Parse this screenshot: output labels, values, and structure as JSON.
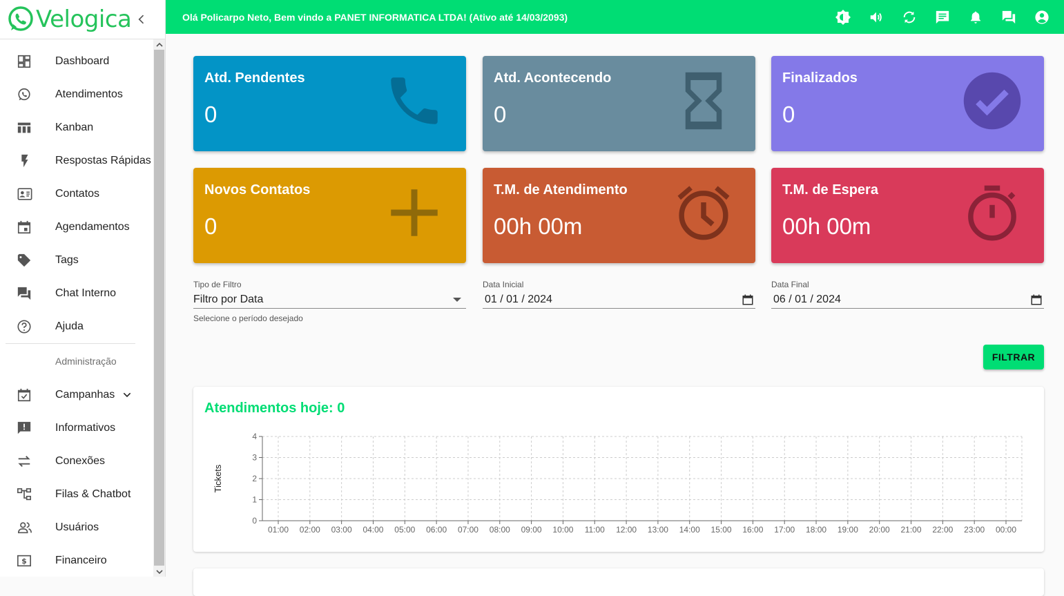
{
  "brand": {
    "logo_text": "Velogica",
    "accent": "#00dd74",
    "logo_color": "#25c35b"
  },
  "sidebar": {
    "items": [
      {
        "label": "Dashboard",
        "icon": "dashboard-icon"
      },
      {
        "label": "Atendimentos",
        "icon": "whatsapp-icon"
      },
      {
        "label": "Kanban",
        "icon": "kanban-icon"
      },
      {
        "label": "Respostas Rápidas",
        "icon": "flash-icon"
      },
      {
        "label": "Contatos",
        "icon": "contact-card-icon"
      },
      {
        "label": "Agendamentos",
        "icon": "calendar-icon"
      },
      {
        "label": "Tags",
        "icon": "tag-icon"
      },
      {
        "label": "Chat Interno",
        "icon": "forum-icon"
      },
      {
        "label": "Ajuda",
        "icon": "help-icon"
      }
    ],
    "admin_header": "Administração",
    "admin_items": [
      {
        "label": "Campanhas",
        "icon": "event-available-icon"
      },
      {
        "label": "Informativos",
        "icon": "announcement-icon"
      },
      {
        "label": "Conexões",
        "icon": "sync-alt-icon"
      },
      {
        "label": "Filas & Chatbot",
        "icon": "account-tree-icon"
      },
      {
        "label": "Usuários",
        "icon": "people-icon"
      },
      {
        "label": "Financeiro",
        "icon": "money-icon"
      }
    ]
  },
  "topbar": {
    "greeting_prefix": "Olá",
    "user": "Policarpo Neto",
    "greeting_mid": ", Bem vindo a",
    "company": "PANET INFORMATICA LTDA!",
    "active_until": "(Ativo até 14/03/2093)"
  },
  "cards": [
    {
      "title": "Atd. Pendentes",
      "value": "0",
      "color": "#0394c6",
      "icon": "phone-icon"
    },
    {
      "title": "Atd. Acontecendo",
      "value": "0",
      "color": "#698c9e",
      "icon": "hourglass-icon"
    },
    {
      "title": "Finalizados",
      "value": "0",
      "color": "#8479e8",
      "icon": "check-circle-icon"
    },
    {
      "title": "Novos Contatos",
      "value": "0",
      "color": "#dc9a02",
      "icon": "plus-icon"
    },
    {
      "title": "T.M. de Atendimento",
      "value": "00h 00m",
      "color": "#c85b33",
      "icon": "alarm-icon"
    },
    {
      "title": "T.M. de Espera",
      "value": "00h 00m",
      "color": "#d93a5a",
      "icon": "timer-icon"
    }
  ],
  "filters": {
    "type_label": "Tipo de Filtro",
    "type_value": "Filtro por Data",
    "type_help": "Selecione o período desejado",
    "start_label": "Data Inicial",
    "start_value": "01 / 01 / 2024",
    "end_label": "Data Final",
    "end_value": "06 / 01 / 2024",
    "button": "FILTRAR"
  },
  "chart_title": "Atendimentos hoje:",
  "chart_count": "0",
  "chart_data": {
    "type": "line",
    "x": [
      "01:00",
      "02:00",
      "03:00",
      "04:00",
      "05:00",
      "06:00",
      "07:00",
      "08:00",
      "09:00",
      "10:00",
      "11:00",
      "12:00",
      "13:00",
      "14:00",
      "15:00",
      "16:00",
      "17:00",
      "18:00",
      "19:00",
      "20:00",
      "21:00",
      "22:00",
      "23:00",
      "00:00"
    ],
    "series": [
      {
        "values": [
          0,
          0,
          0,
          0,
          0,
          0,
          0,
          0,
          0,
          0,
          0,
          0,
          0,
          0,
          0,
          0,
          0,
          0,
          0,
          0,
          0,
          0,
          0,
          0
        ]
      }
    ],
    "ylabel": "Tickets",
    "xlabel": "",
    "ylim": [
      0,
      4
    ],
    "yticks": [
      0,
      1,
      2,
      3,
      4
    ],
    "grid": true
  }
}
